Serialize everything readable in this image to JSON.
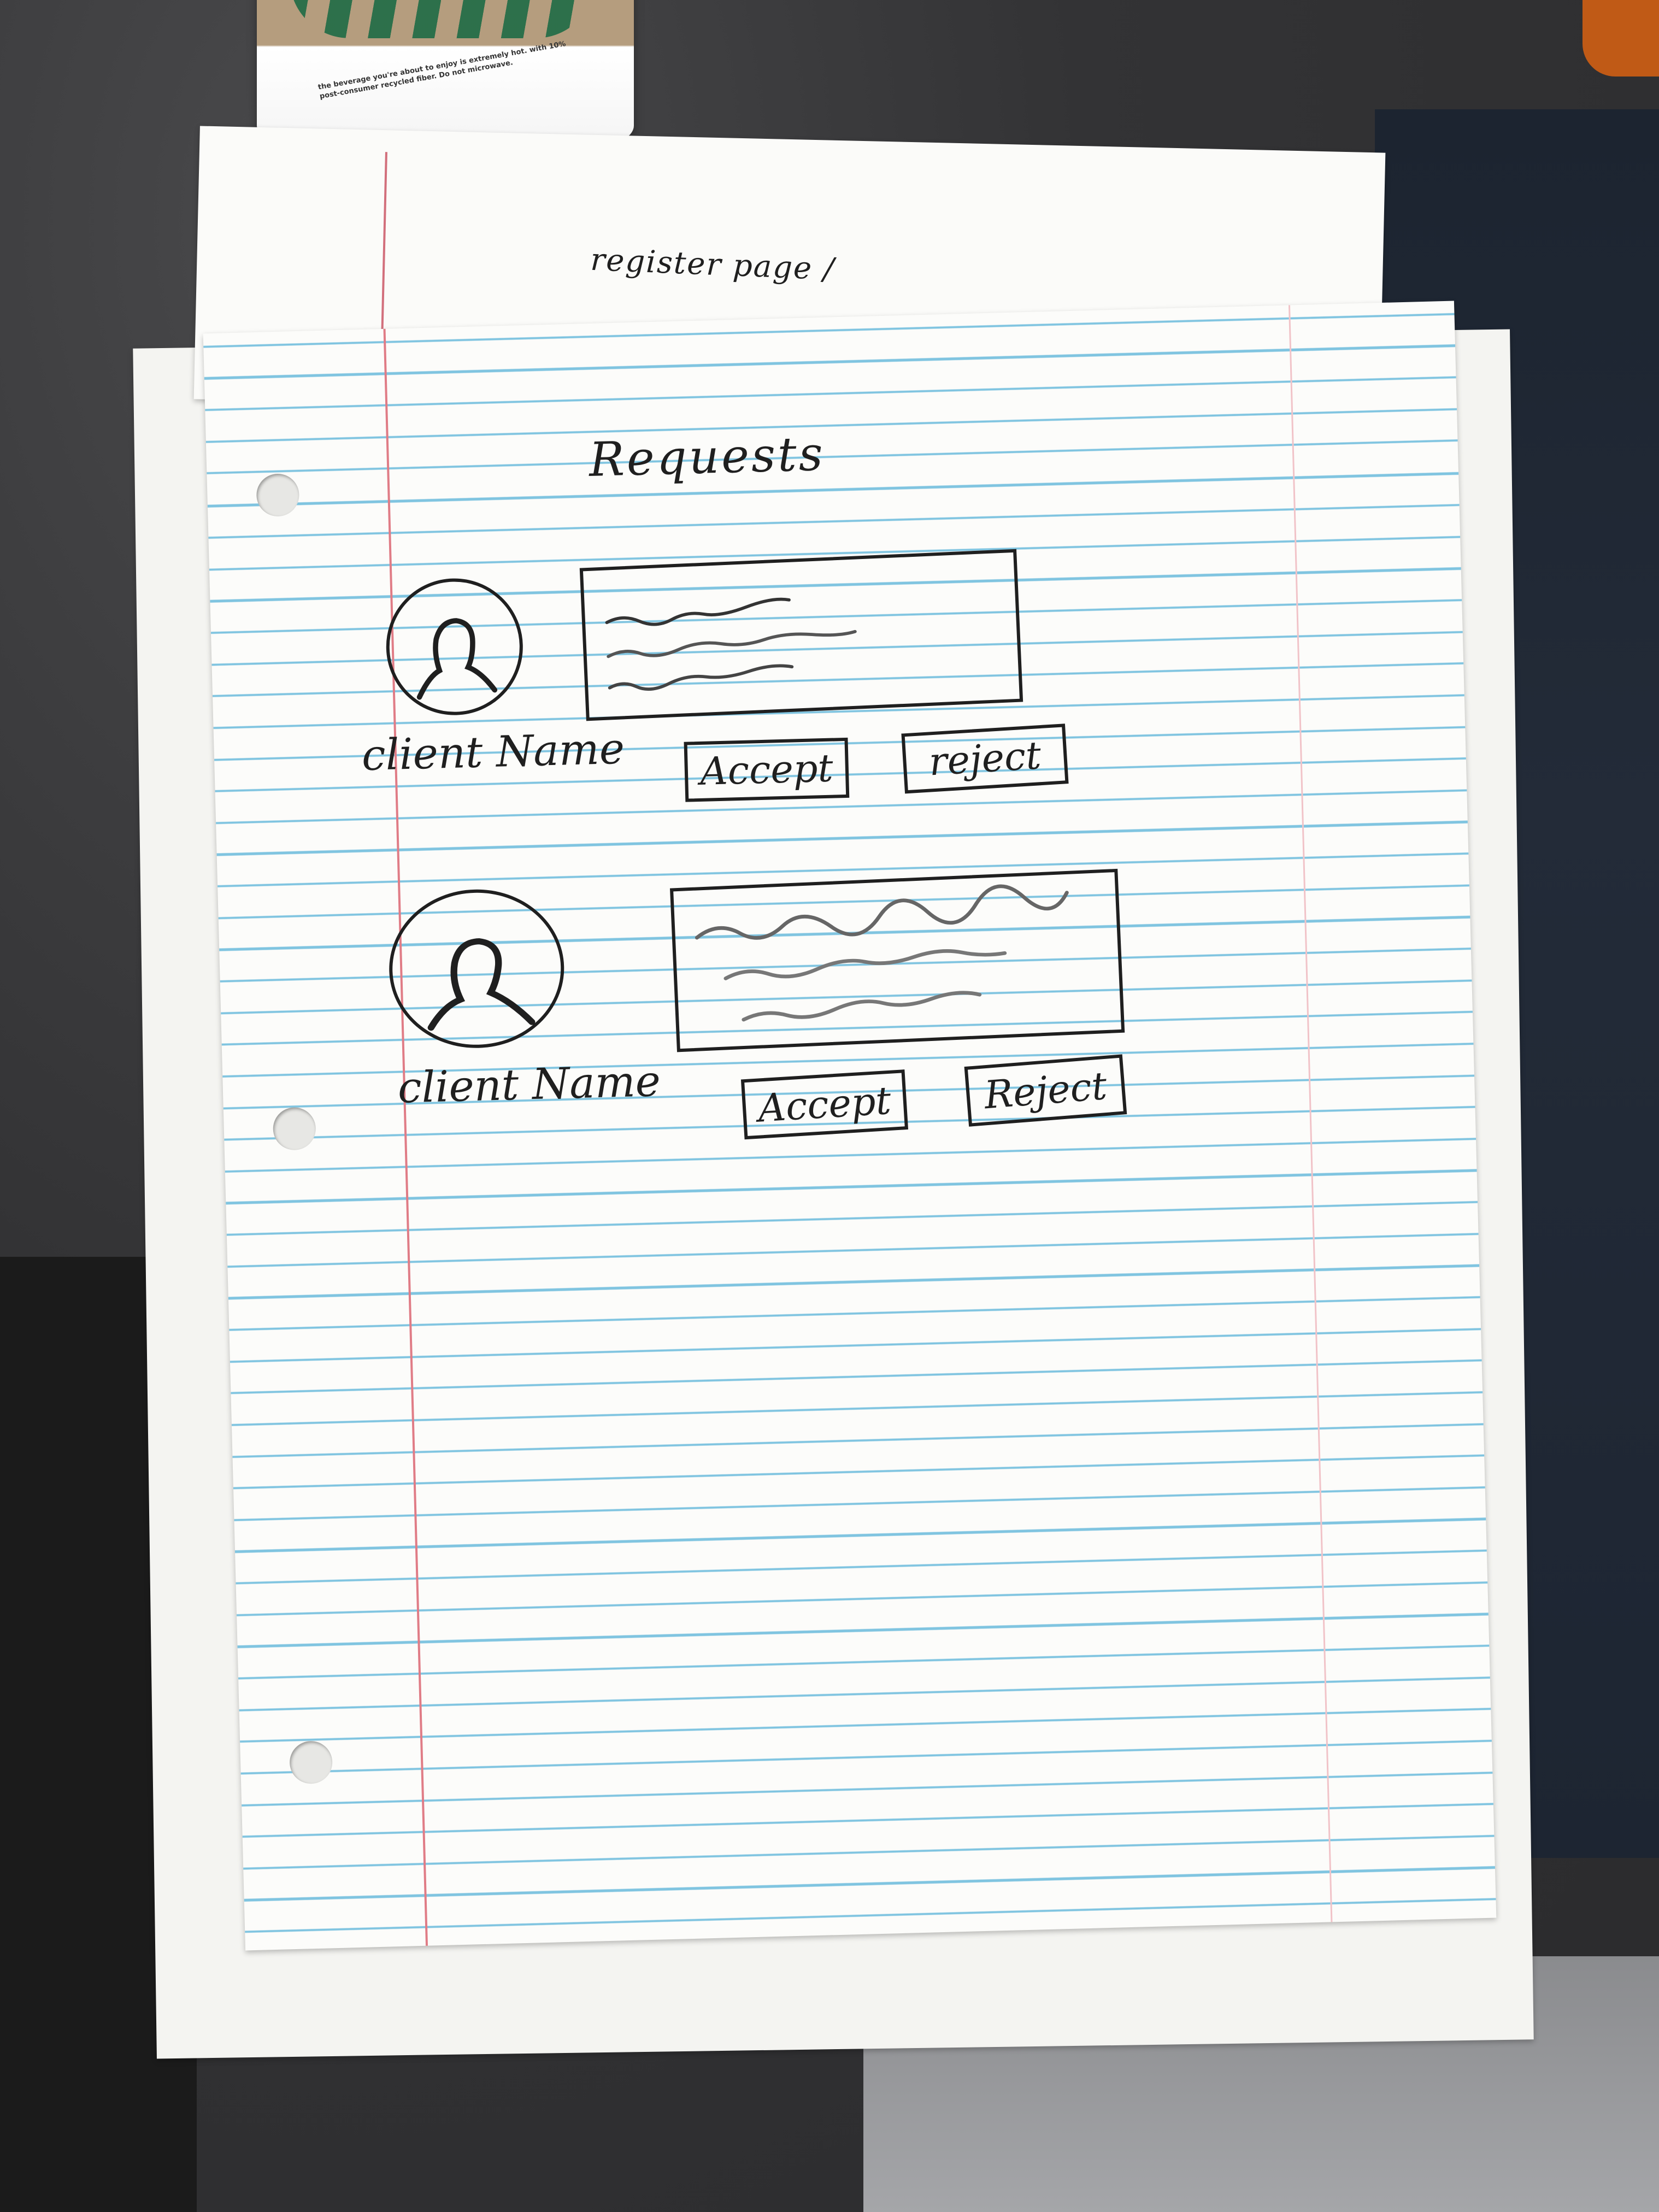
{
  "background_sheet": {
    "title": "register page / "
  },
  "cup_print": "the beverage you're about to enjoy is extremely hot. with 10% post-consumer recycled fiber. Do not microwave.",
  "page": {
    "title": "Requests"
  },
  "requests": [
    {
      "client_name": "client Name",
      "accept_label": "Accept",
      "reject_label": "reject"
    },
    {
      "client_name": "client Name",
      "accept_label": "Accept",
      "reject_label": "Reject"
    }
  ],
  "icons": {
    "avatar": "user-silhouette-icon"
  },
  "colors": {
    "ink": "#1f1f1f",
    "ruled_line": "#7fc4e0",
    "margin_line": "#e07c86",
    "paper": "#fcfcfa"
  }
}
